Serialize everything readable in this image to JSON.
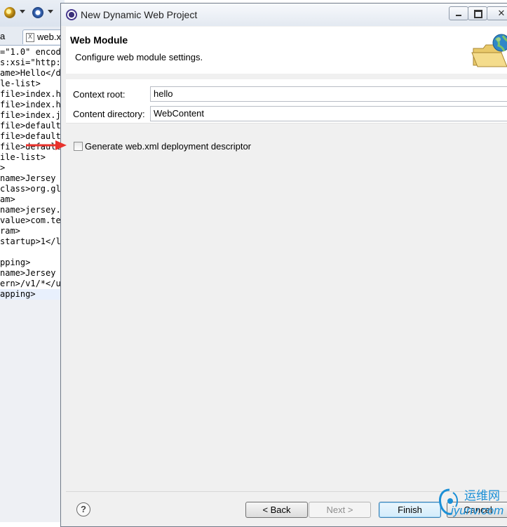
{
  "editor": {
    "tabs": [
      {
        "label": "a"
      },
      {
        "label": "web.x"
      }
    ],
    "lines": [
      "=\"1.0\" encod",
      "s:xsi=\"http:",
      "ame>Hello</di",
      "le-list>",
      "file>index.h",
      "file>index.h",
      "file>index.j",
      "file>default",
      "file>default",
      "file>default",
      "ile-list>",
      ">",
      "name>Jersey",
      "class>org.gl",
      "am>",
      "name>jersey.",
      "value>com.te",
      "ram>",
      "startup>1</l",
      "",
      "pping>",
      "name>Jersey",
      "ern>/v1/*</u",
      "apping>"
    ]
  },
  "dialog": {
    "title": "New Dynamic Web Project",
    "window_buttons": {
      "minimize": "—",
      "maximize": "□",
      "close": "✕"
    },
    "header": {
      "title": "Web Module",
      "description": "Configure web module settings.",
      "graphic": "folder-globe-icon"
    },
    "form": {
      "context_root_label": "Context root:",
      "context_root_value": "hello",
      "content_dir_label": "Content directory:",
      "content_dir_value": "WebContent"
    },
    "generate_descriptor": {
      "label": "Generate web.xml deployment descriptor",
      "checked": false
    },
    "buttons": {
      "help": "?",
      "back": "< Back",
      "next": "Next >",
      "finish": "Finish",
      "cancel": "Cancel"
    },
    "annotation_color": "#e8322c"
  },
  "watermark": {
    "cn": "运维网",
    "en": "iyunv.com"
  }
}
